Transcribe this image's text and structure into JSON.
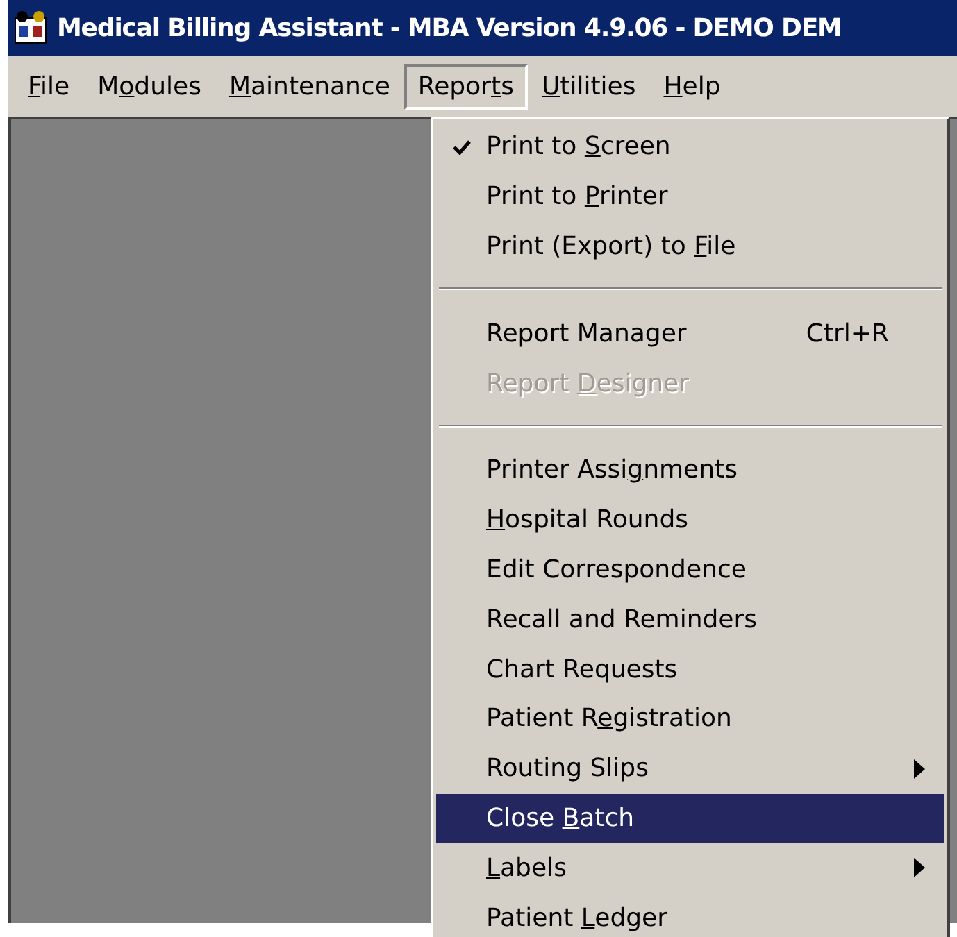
{
  "window": {
    "title": "Medical Billing Assistant - MBA Version 4.9.06 - DEMO DEM"
  },
  "menu_bar": [
    {
      "key": "F",
      "after": "ile",
      "selected": false
    },
    {
      "before": "M",
      "key": "o",
      "after": "dules",
      "selected": false
    },
    {
      "key": "M",
      "after": "aintenance",
      "selected": false
    },
    {
      "before": "Repor",
      "key": "t",
      "after": "s",
      "selected": true
    },
    {
      "key": "U",
      "after": "tilities",
      "selected": false
    },
    {
      "key": "H",
      "after": "elp",
      "selected": false
    }
  ],
  "dropdown": [
    {
      "kind": "item",
      "before": "Print to ",
      "key": "S",
      "after": "creen",
      "checked": true,
      "disabled": false,
      "selected": false
    },
    {
      "kind": "item",
      "before": "Print to ",
      "key": "P",
      "after": "rinter",
      "checked": false,
      "disabled": false,
      "selected": false
    },
    {
      "kind": "item",
      "before": "Print (Export) to ",
      "key": "F",
      "after": "ile",
      "checked": false,
      "disabled": false,
      "selected": false
    },
    {
      "kind": "separator"
    },
    {
      "kind": "item",
      "before": "Report Manager",
      "shortcut": "Ctrl+R",
      "checked": false,
      "disabled": false,
      "selected": false
    },
    {
      "kind": "item",
      "before": "Report ",
      "key": "D",
      "after": "esigner",
      "checked": false,
      "disabled": true,
      "selected": false
    },
    {
      "kind": "separator"
    },
    {
      "kind": "item",
      "before": "Printer Assi",
      "key": "g",
      "after": "nments",
      "checked": false,
      "disabled": false,
      "selected": false
    },
    {
      "kind": "item",
      "key": "H",
      "after": "ospital Rounds",
      "checked": false,
      "disabled": false,
      "selected": false
    },
    {
      "kind": "item",
      "before": "Edit Correspondence",
      "checked": false,
      "disabled": false,
      "selected": false
    },
    {
      "kind": "item",
      "before": "Recall and Reminders",
      "checked": false,
      "disabled": false,
      "selected": false
    },
    {
      "kind": "item",
      "before": "Chart Requests",
      "checked": false,
      "disabled": false,
      "selected": false
    },
    {
      "kind": "item",
      "before": "Patient R",
      "key": "e",
      "after": "gistration",
      "checked": false,
      "disabled": false,
      "selected": false
    },
    {
      "kind": "submenu",
      "before": "Routing Slips",
      "checked": false,
      "disabled": false,
      "selected": false
    },
    {
      "kind": "item",
      "before": "Close ",
      "key": "B",
      "after": "atch",
      "checked": false,
      "disabled": false,
      "selected": true
    },
    {
      "kind": "submenu",
      "key": "L",
      "after": "abels",
      "checked": false,
      "disabled": false,
      "selected": false
    },
    {
      "kind": "item",
      "before": "Patient ",
      "key": "L",
      "after": "edger",
      "checked": false,
      "disabled": false,
      "selected": false
    }
  ]
}
